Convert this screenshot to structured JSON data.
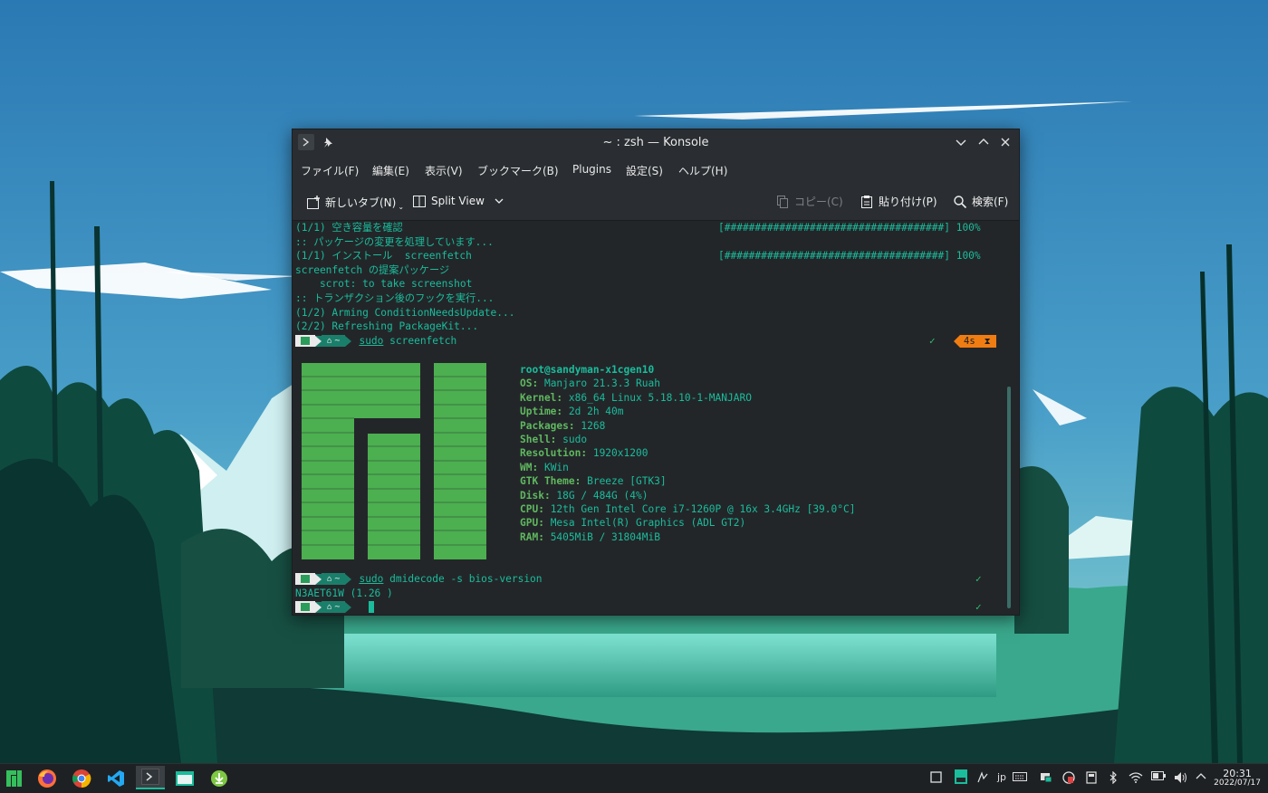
{
  "window": {
    "title": "~ : zsh — Konsole",
    "menu": [
      "ファイル(F)",
      "編集(E)",
      "表示(V)",
      "ブックマーク(B)",
      "Plugins",
      "設定(S)",
      "ヘルプ(H)"
    ],
    "toolbar": {
      "new_tab": "新しいタブ(N)",
      "split_view": "Split View",
      "copy": "コピー(C)",
      "paste": "貼り付け(P)",
      "search": "検索(F)"
    }
  },
  "terminal": {
    "lines": [
      "(1/1) 空き容量を確認",
      ":: パッケージの変更を処理しています...",
      "(1/1) インストール  screenfetch",
      "screenfetch の提案パッケージ",
      "    scrot: to take screenshot",
      ":: トランザクション後のフックを実行...",
      "(1/2) Arming ConditionNeedsUpdate...",
      "(2/2) Refreshing PackageKit..."
    ],
    "progress_bars": [
      {
        "bar": "[####################################]",
        "percent": "100%"
      },
      {
        "bar": "[####################################]",
        "percent": "100%"
      }
    ],
    "prompt_dir": "~",
    "commands": [
      {
        "sudo": "sudo",
        "rest": " screenfetch"
      },
      {
        "sudo": "sudo",
        "rest": " dmidecode -s bios-version"
      }
    ],
    "duration_badge": "4s",
    "check_mark": "✓",
    "bios_output": "N3AET61W (1.26 )",
    "screenfetch": {
      "user_host": "root@sandyman-x1cgen10",
      "fields": [
        {
          "key": "OS:",
          "value": " Manjaro 21.3.3 Ruah"
        },
        {
          "key": "Kernel:",
          "value": " x86_64 Linux 5.18.10-1-MANJARO"
        },
        {
          "key": "Uptime:",
          "value": " 2d 2h 40m"
        },
        {
          "key": "Packages:",
          "value": " 1268"
        },
        {
          "key": "Shell:",
          "value": " sudo"
        },
        {
          "key": "Resolution:",
          "value": " 1920x1200"
        },
        {
          "key": "WM:",
          "value": " KWin"
        },
        {
          "key": "GTK Theme:",
          "value": " Breeze [GTK3]"
        },
        {
          "key": "Disk:",
          "value": " 18G / 484G (4%)"
        },
        {
          "key": "CPU:",
          "value": " 12th Gen Intel Core i7-1260P @ 16x 3.4GHz [39.0°C]"
        },
        {
          "key": "GPU:",
          "value": " Mesa Intel(R) Graphics (ADL GT2)"
        },
        {
          "key": "RAM:",
          "value": " 5405MiB / 31804MiB"
        }
      ]
    }
  },
  "taskbar": {
    "apps": [
      "manjaro-menu-icon",
      "firefox-icon",
      "chrome-icon",
      "vscode-icon",
      "konsole-icon",
      "file-manager-icon",
      "download-icon"
    ],
    "keyboard_layout": "jp",
    "time": "20:31",
    "date": "2022/07/17"
  },
  "colors": {
    "terminal_text": "#1abc9c",
    "manjaro_green": "#5fb85f",
    "badge_orange": "#f07d12"
  }
}
